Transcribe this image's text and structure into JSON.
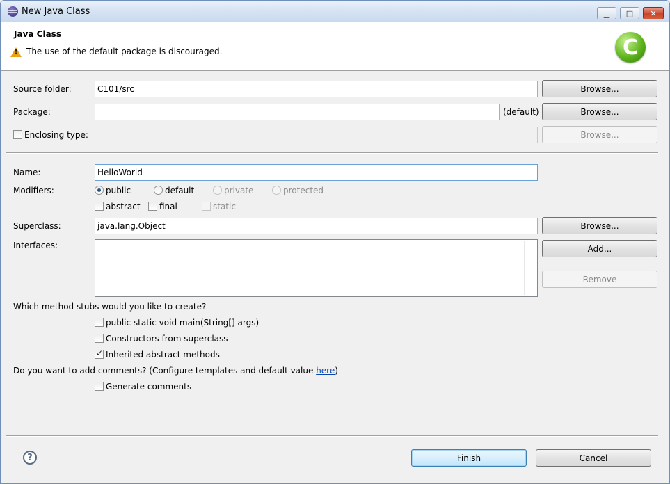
{
  "window": {
    "title": "New Java Class",
    "controls": {
      "minimize": "▁",
      "maximize": "□",
      "close": "✕"
    }
  },
  "banner": {
    "title": "Java Class",
    "message": "The use of the default package is discouraged.",
    "logo_letter": "C",
    "warning_icon": "warning-icon"
  },
  "form": {
    "source_folder": {
      "label": "Source folder:",
      "value": "C101/src",
      "button": "Browse..."
    },
    "package": {
      "label": "Package:",
      "value": "",
      "suffix": "(default)",
      "button": "Browse..."
    },
    "enclosing_type": {
      "label": "Enclosing type:",
      "value": "",
      "checked": false,
      "button": "Browse..."
    },
    "name": {
      "label": "Name:",
      "value": "HelloWorld"
    },
    "modifiers": {
      "label": "Modifiers:",
      "radios": [
        {
          "label": "public",
          "checked": true,
          "enabled": true
        },
        {
          "label": "default",
          "checked": false,
          "enabled": true
        },
        {
          "label": "private",
          "checked": false,
          "enabled": false
        },
        {
          "label": "protected",
          "checked": false,
          "enabled": false
        }
      ],
      "checks": [
        {
          "label": "abstract",
          "checked": false,
          "enabled": true
        },
        {
          "label": "final",
          "checked": false,
          "enabled": true
        },
        {
          "label": "static",
          "checked": false,
          "enabled": false
        }
      ]
    },
    "superclass": {
      "label": "Superclass:",
      "value": "java.lang.Object",
      "button": "Browse..."
    },
    "interfaces": {
      "label": "Interfaces:",
      "add_button": "Add...",
      "remove_button": "Remove",
      "items": []
    },
    "stubs": {
      "question": "Which method stubs would you like to create?",
      "options": [
        {
          "label": "public static void main(String[] args)",
          "checked": false
        },
        {
          "label": "Constructors from superclass",
          "checked": false
        },
        {
          "label": "Inherited abstract methods",
          "checked": true
        }
      ]
    },
    "comments": {
      "question_prefix": "Do you want to add comments? (Configure templates and default value ",
      "link": "here",
      "question_suffix": ")",
      "option": {
        "label": "Generate comments",
        "checked": false
      }
    }
  },
  "footer": {
    "help_icon": "?",
    "finish": "Finish",
    "cancel": "Cancel"
  }
}
